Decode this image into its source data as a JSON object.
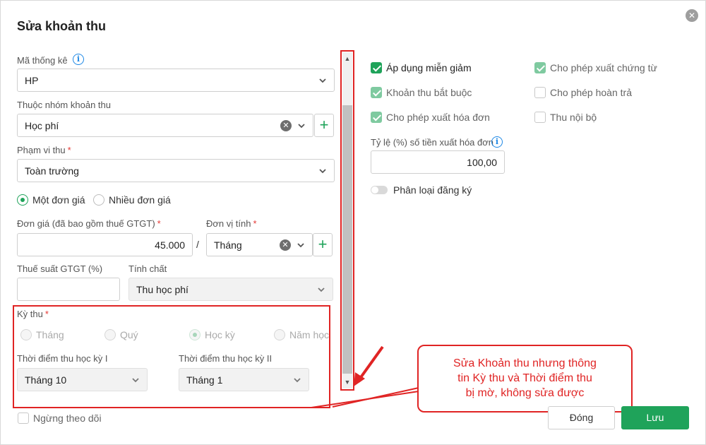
{
  "dialog": {
    "title": "Sửa khoản thu",
    "close_icon": "close-icon"
  },
  "ma_thong_ke": {
    "label": "Mã thống kê",
    "value": "HP"
  },
  "nhom_khoan_thu": {
    "label": "Thuộc nhóm khoản thu",
    "value": "Học phí"
  },
  "pham_vi_thu": {
    "label": "Phạm vi thu",
    "value": "Toàn trường"
  },
  "don_gia_mode": {
    "option_one": "Một đơn giá",
    "option_many": "Nhiều đơn giá",
    "selected": "Một đơn giá"
  },
  "don_gia": {
    "label": "Đơn giá (đã bao gồm thuế GTGT)",
    "value": "45.000"
  },
  "separator": "/",
  "don_vi_tinh": {
    "label": "Đơn vị tính",
    "value": "Tháng"
  },
  "thue_suat": {
    "label": "Thuế suất GTGT (%)",
    "value": ""
  },
  "tinh_chat": {
    "label": "Tính chất",
    "value": "Thu học phí"
  },
  "ky_thu": {
    "label": "Kỳ thu",
    "options": [
      "Tháng",
      "Quý",
      "Học kỳ",
      "Năm học"
    ],
    "selected": "Học kỳ"
  },
  "thoi_diem_hk1": {
    "label": "Thời điểm thu học kỳ I",
    "value": "Tháng 10"
  },
  "thoi_diem_hk2": {
    "label": "Thời điểm thu học kỳ II",
    "value": "Tháng 1"
  },
  "ngung_theo_doi": {
    "label": "Ngừng theo dõi",
    "checked": false
  },
  "options": {
    "ap_dung_mien_giam": {
      "label": "Áp dụng miễn giảm",
      "checked": true
    },
    "khoan_thu_bat_buoc": {
      "label": "Khoản thu bắt buộc",
      "checked": true
    },
    "cho_phep_xuat_hoa_don": {
      "label": "Cho phép xuất hóa đơn",
      "checked": true
    },
    "cho_phep_xuat_chung_tu": {
      "label": "Cho phép xuất chứng từ",
      "checked": true
    },
    "cho_phep_hoan_tra": {
      "label": "Cho phép hoàn trả",
      "checked": false
    },
    "thu_noi_bo": {
      "label": "Thu nội bộ",
      "checked": false
    }
  },
  "ty_le": {
    "label": "Tỷ lệ (%) số tiền xuất hóa đơn",
    "value": "100,00"
  },
  "phan_loai_dang_ky": {
    "label": "Phân loại đăng ký",
    "on": false
  },
  "annotation": {
    "text_line1": "Sửa Khoản thu nhưng thông",
    "text_line2": "tin Kỳ thu và Thời điểm thu",
    "text_line3": "bị mờ, không sửa được"
  },
  "footer": {
    "close_label": "Đóng",
    "save_label": "Lưu"
  },
  "colors": {
    "accent": "#1fa35a",
    "annotation": "#e02424",
    "info": "#1e88e5"
  }
}
